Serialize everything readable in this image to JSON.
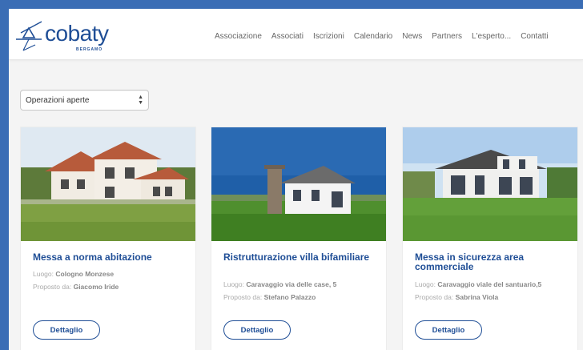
{
  "brand": {
    "name": "cobaty",
    "subtitle": "BERGAMO",
    "color": "#1f4e96"
  },
  "nav": [
    "Associazione",
    "Associati",
    "Iscrizioni",
    "Calendario",
    "News",
    "Partners",
    "L'esperto...",
    "Contatti"
  ],
  "filter": {
    "selected": "Operazioni aperte",
    "icon": "updown-arrows-icon"
  },
  "cards": [
    {
      "title": "Messa a norma abitazione",
      "location_label": "Luogo:",
      "location": "Cologno Monzese",
      "proposer_label": "Proposto da:",
      "proposer": "Giacomo Iride",
      "button": "Dettaglio"
    },
    {
      "title": "Ristrutturazione villa bifamiliare",
      "location_label": "Luogo:",
      "location": "Caravaggio via delle case, 5",
      "proposer_label": "Proposto da:",
      "proposer": "Stefano Palazzo",
      "button": "Dettaglio"
    },
    {
      "title": "Messa in sicurezza area commerciale",
      "location_label": "Luogo:",
      "location": "Caravaggio viale del santuario,5",
      "proposer_label": "Proposto da:",
      "proposer": "Sabrina Viola",
      "button": "Dettaglio"
    }
  ]
}
